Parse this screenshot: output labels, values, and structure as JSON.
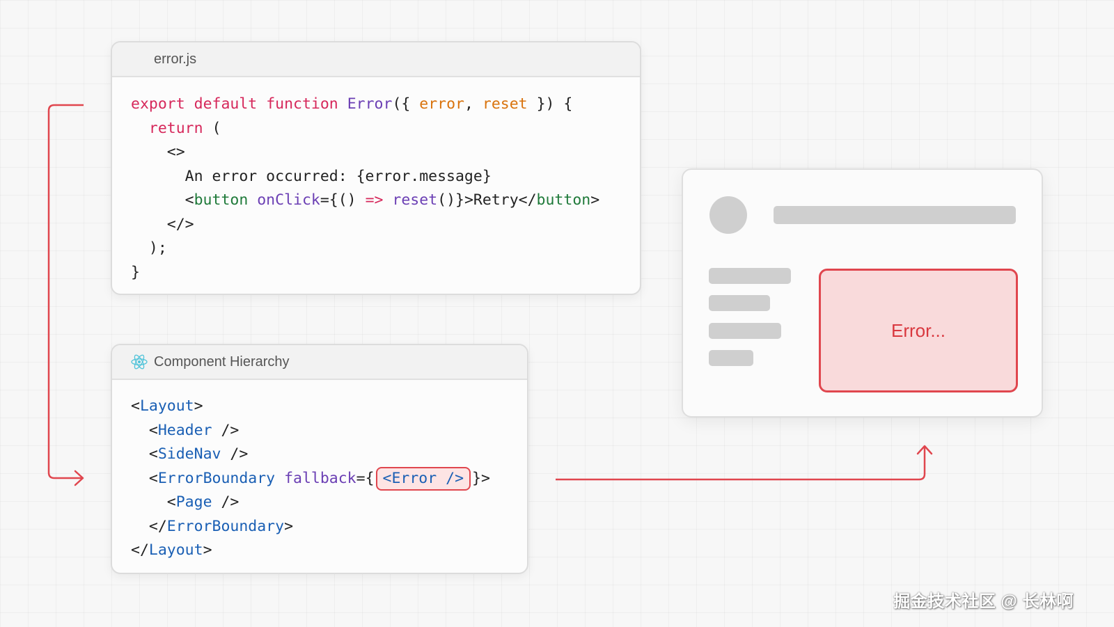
{
  "error_panel": {
    "filename": "error.js",
    "code_lines": [
      [
        {
          "t": "export",
          "c": "kw"
        },
        {
          "t": " "
        },
        {
          "t": "default",
          "c": "kw"
        },
        {
          "t": " "
        },
        {
          "t": "function",
          "c": "kw"
        },
        {
          "t": " "
        },
        {
          "t": "Error",
          "c": "fn"
        },
        {
          "t": "({ "
        },
        {
          "t": "error",
          "c": "par"
        },
        {
          "t": ", "
        },
        {
          "t": "reset",
          "c": "par"
        },
        {
          "t": " }) {"
        }
      ],
      [
        {
          "t": "  "
        },
        {
          "t": "return",
          "c": "kw"
        },
        {
          "t": " ("
        }
      ],
      [
        {
          "t": "    <>"
        }
      ],
      [
        {
          "t": "      An error occurred: {error.message}"
        }
      ],
      [
        {
          "t": "      <"
        },
        {
          "t": "button",
          "c": "jsxt"
        },
        {
          "t": " "
        },
        {
          "t": "onClick",
          "c": "attr"
        },
        {
          "t": "={() ",
          "c": ""
        },
        {
          "t": "=>",
          "c": "arr"
        },
        {
          "t": " "
        },
        {
          "t": "reset",
          "c": "call"
        },
        {
          "t": "()}>Retry</"
        },
        {
          "t": "button",
          "c": "jsxt"
        },
        {
          "t": ">"
        }
      ],
      [
        {
          "t": "    </>"
        }
      ],
      [
        {
          "t": "  );"
        }
      ],
      [
        {
          "t": "}"
        }
      ]
    ]
  },
  "hierarchy_panel": {
    "title": "Component Hierarchy",
    "icon": "react-icon",
    "code_lines": [
      [
        {
          "t": "<"
        },
        {
          "t": "Layout",
          "c": "tag"
        },
        {
          "t": ">"
        }
      ],
      [
        {
          "t": "  <"
        },
        {
          "t": "Header",
          "c": "tag"
        },
        {
          "t": " />"
        }
      ],
      [
        {
          "t": "  <"
        },
        {
          "t": "SideNav",
          "c": "tag"
        },
        {
          "t": " />"
        }
      ],
      [
        {
          "t": "  <"
        },
        {
          "t": "ErrorBoundary",
          "c": "tag"
        },
        {
          "t": " "
        },
        {
          "t": "fallback",
          "c": "attr"
        },
        {
          "t": "={"
        },
        {
          "t": "<Error />",
          "c": "hl"
        },
        {
          "t": "}>"
        }
      ],
      [
        {
          "t": "    <"
        },
        {
          "t": "Page",
          "c": "tag"
        },
        {
          "t": " />"
        }
      ],
      [
        {
          "t": "  </"
        },
        {
          "t": "ErrorBoundary",
          "c": "tag"
        },
        {
          "t": ">"
        }
      ],
      [
        {
          "t": "</"
        },
        {
          "t": "Layout",
          "c": "tag"
        },
        {
          "t": ">"
        }
      ]
    ]
  },
  "preview": {
    "error_text": "Error..."
  },
  "watermark": "掘金技术社区 @ 长林啊",
  "colors": {
    "accent_red": "#e0464e",
    "error_fill": "#f9dadb",
    "skeleton": "#cfcfcf"
  }
}
